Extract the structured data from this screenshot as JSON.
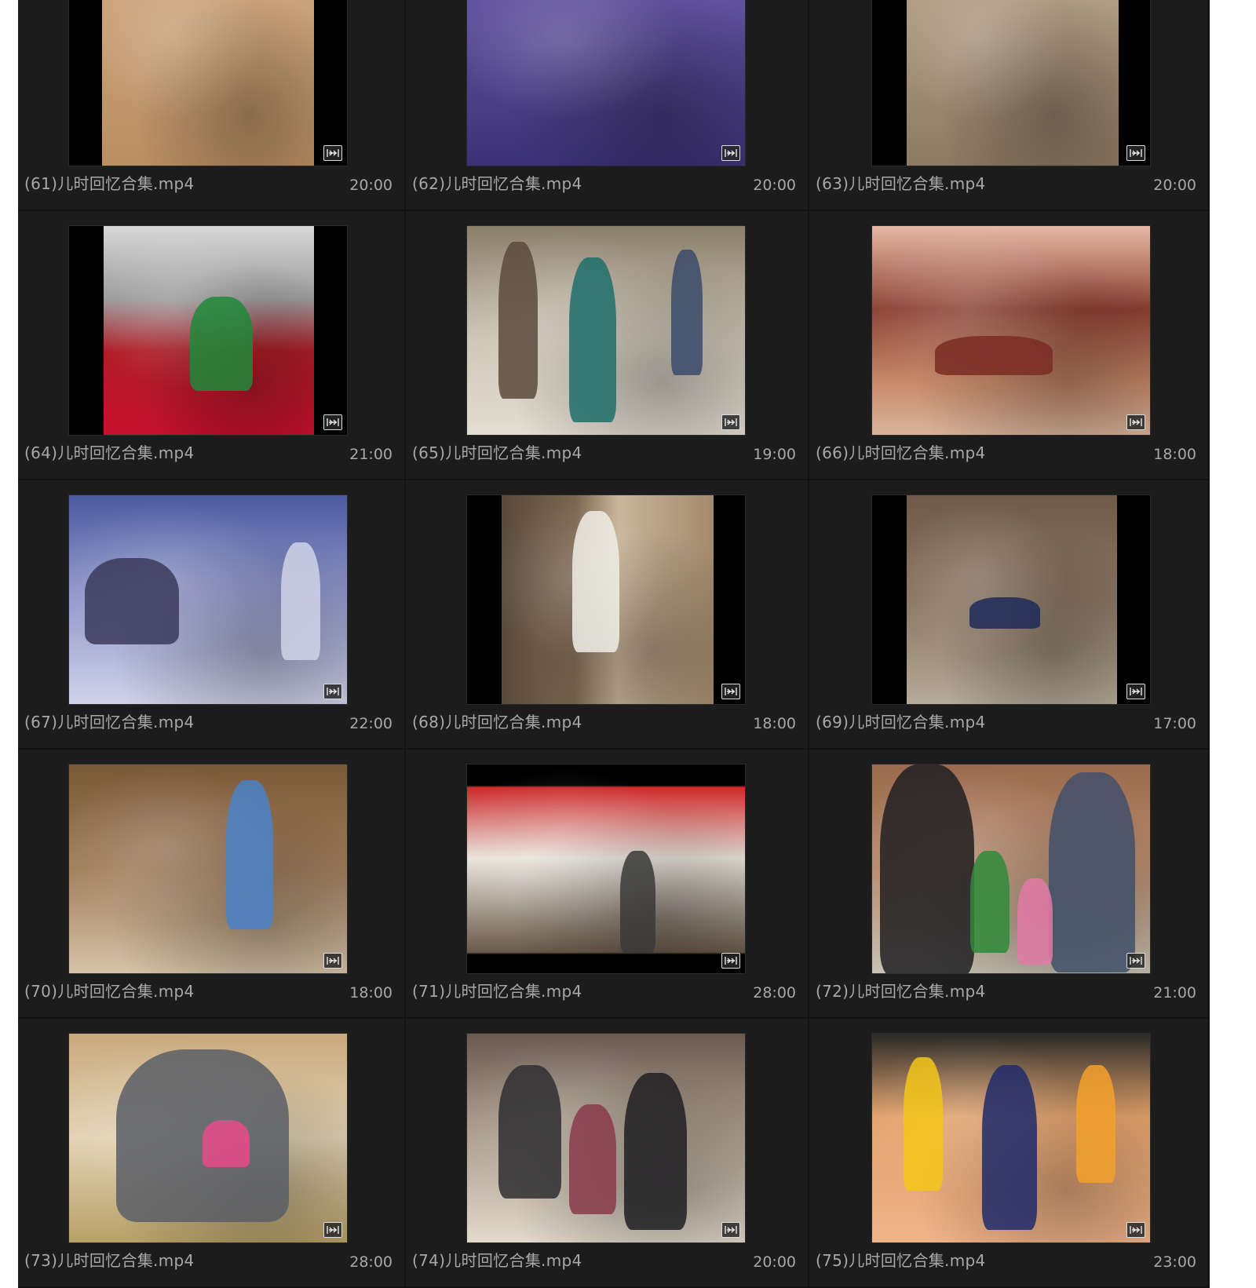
{
  "videos": [
    {
      "name": "(61)儿时回忆合集.mp4",
      "duration": "20:00",
      "icon": "media-badge-icon"
    },
    {
      "name": "(62)儿时回忆合集.mp4",
      "duration": "20:00",
      "icon": "media-badge-icon"
    },
    {
      "name": "(63)儿时回忆合集.mp4",
      "duration": "20:00",
      "icon": "media-badge-icon"
    },
    {
      "name": "(64)儿时回忆合集.mp4",
      "duration": "21:00",
      "icon": "media-badge-icon"
    },
    {
      "name": "(65)儿时回忆合集.mp4",
      "duration": "19:00",
      "icon": "media-badge-icon"
    },
    {
      "name": "(66)儿时回忆合集.mp4",
      "duration": "18:00",
      "icon": "media-badge-icon"
    },
    {
      "name": "(67)儿时回忆合集.mp4",
      "duration": "22:00",
      "icon": "media-badge-icon"
    },
    {
      "name": "(68)儿时回忆合集.mp4",
      "duration": "18:00",
      "icon": "media-badge-icon"
    },
    {
      "name": "(69)儿时回忆合集.mp4",
      "duration": "17:00",
      "icon": "media-badge-icon"
    },
    {
      "name": "(70)儿时回忆合集.mp4",
      "duration": "18:00",
      "icon": "media-badge-icon"
    },
    {
      "name": "(71)儿时回忆合集.mp4",
      "duration": "28:00",
      "icon": "media-badge-icon"
    },
    {
      "name": "(72)儿时回忆合集.mp4",
      "duration": "21:00",
      "icon": "media-badge-icon"
    },
    {
      "name": "(73)儿时回忆合集.mp4",
      "duration": "28:00",
      "icon": "media-badge-icon"
    },
    {
      "name": "(74)儿时回忆合集.mp4",
      "duration": "20:00",
      "icon": "media-badge-icon"
    },
    {
      "name": "(75)儿时回忆合集.mp4",
      "duration": "23:00",
      "icon": "media-badge-icon"
    }
  ],
  "colors": {
    "panel_background": "#151515",
    "cell_background": "#1c1c1c",
    "text": "#a8a8a8"
  }
}
